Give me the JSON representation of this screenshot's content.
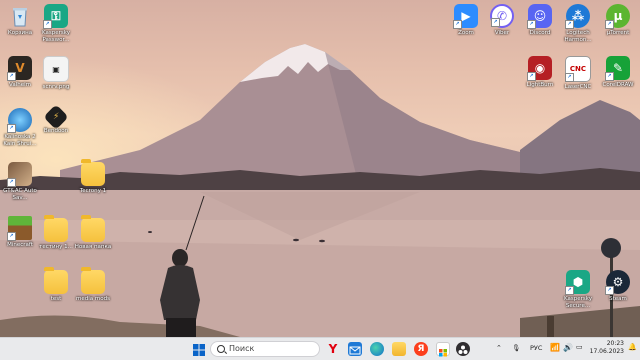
{
  "desktop": {
    "icons": [
      {
        "name": "recycle-bin-icon",
        "label": "Корзина"
      },
      {
        "name": "kaspersky-password-icon",
        "label": "Kaspersky Passwor..."
      },
      {
        "name": "valheim-icon",
        "label": "Valheim"
      },
      {
        "name": "screenshot-file-icon",
        "label": "scnrv.png"
      },
      {
        "name": "kalinka-icon",
        "label": "Kalinoska 2 Kain Shrui..."
      },
      {
        "name": "bendoon-icon",
        "label": "Bendoon"
      },
      {
        "name": "ac-app-icon",
        "label": "GT&AC Auto Sav..."
      },
      {
        "name": "folder-icon",
        "label": "Tecrony 1"
      },
      {
        "name": "minecraft-icon",
        "label": "Minecraft"
      },
      {
        "name": "folder-icon",
        "label": "тестину 1..."
      },
      {
        "name": "folder-icon",
        "label": "Новая папка"
      },
      {
        "name": "folder-icon",
        "label": "test"
      },
      {
        "name": "folder-icon",
        "label": "media mods"
      },
      {
        "name": "zoom-icon",
        "label": "Zoom"
      },
      {
        "name": "viber-icon",
        "label": "Viber"
      },
      {
        "name": "discord-icon",
        "label": "Discord"
      },
      {
        "name": "logitech-icon",
        "label": "Logitech Harmon..."
      },
      {
        "name": "utorrent-icon",
        "label": "µTorrent"
      },
      {
        "name": "lightburn-icon",
        "label": "LightBurn"
      },
      {
        "name": "lasercnc-icon",
        "label": "LaserCNC"
      },
      {
        "name": "coreldraw-icon",
        "label": "CorelDRAW"
      },
      {
        "name": "kaspersky-secure-icon",
        "label": "Kaspersky Secure..."
      },
      {
        "name": "steam-icon",
        "label": "Steam"
      }
    ]
  },
  "taskbar": {
    "search_placeholder": "Поиск",
    "language": "РУС",
    "time": "20:23",
    "date": "17.06.2023",
    "pinned": [
      "windows-start-icon",
      "yandex-browser-icon",
      "mail-icon",
      "edge-icon",
      "file-explorer-icon",
      "yandex-icon",
      "store-icon",
      "obs-icon"
    ]
  },
  "colors": {
    "accent": "#0a64c8",
    "taskbar_bg": "#e9eaec"
  }
}
